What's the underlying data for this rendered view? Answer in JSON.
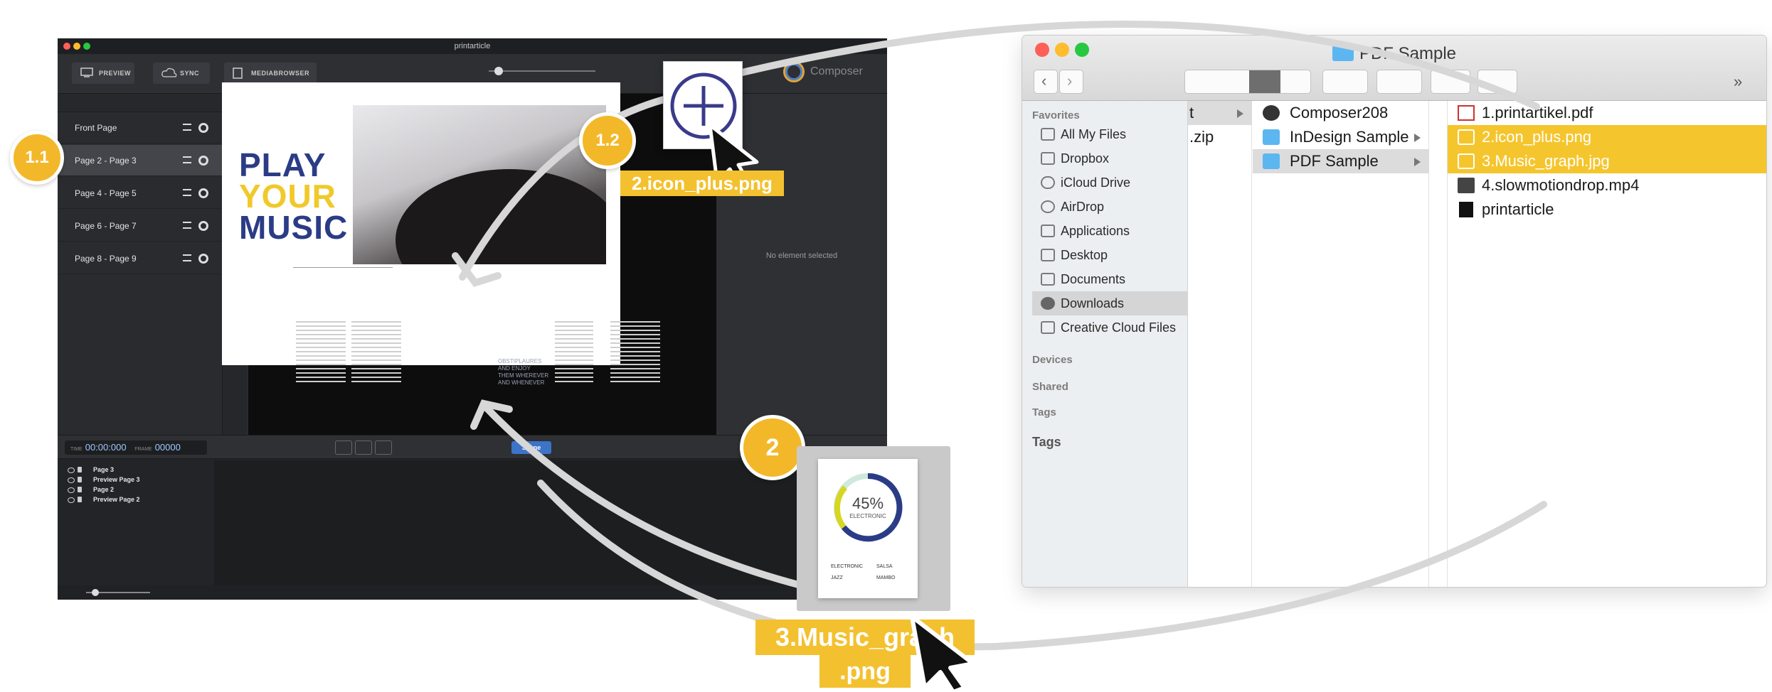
{
  "composer": {
    "window_title": "printarticle",
    "toolbar": {
      "preview": "PREVIEW",
      "sync": "SYNC",
      "mediabrowser": "MEDIABROWSER",
      "brand": "Composer"
    },
    "pages": [
      {
        "label": "Front Page"
      },
      {
        "label": "Page 2 - Page 3"
      },
      {
        "label": "Page 4 - Page 5"
      },
      {
        "label": "Page 6 - Page 7"
      },
      {
        "label": "Page 8 - Page 9"
      }
    ],
    "selected_page": "Page 2 - Page 3",
    "document": {
      "headline": [
        "PLAY",
        "YOUR",
        "MUSIC"
      ],
      "headline_colors": [
        "#2b3c86",
        "#f0c92a",
        "#2b3c86"
      ],
      "pull_quote": [
        "OBSTIPLAURES",
        "AND ENJOY",
        "THEM WHEREVER",
        "AND WHENEVER"
      ]
    },
    "properties": {
      "empty_message": "No element selected"
    },
    "timeline": {
      "time_label": "TIME",
      "time": "00:00:000",
      "frame_label": "FRAME",
      "frame": "00000",
      "scene_button": "Scene",
      "layers": [
        "Page 3",
        "Preview Page 3",
        "Page 2",
        "Preview Page 2"
      ]
    }
  },
  "finder": {
    "title": "PDF Sample",
    "sidebar": {
      "favorites_header": "Favorites",
      "items": [
        {
          "label": "All My Files",
          "icon": "all-files-icon"
        },
        {
          "label": "Dropbox",
          "icon": "dropbox-icon"
        },
        {
          "label": "iCloud Drive",
          "icon": "cloud-icon"
        },
        {
          "label": "AirDrop",
          "icon": "airdrop-icon"
        },
        {
          "label": "Applications",
          "icon": "applications-icon"
        },
        {
          "label": "Desktop",
          "icon": "desktop-icon"
        },
        {
          "label": "Documents",
          "icon": "documents-icon"
        },
        {
          "label": "Downloads",
          "icon": "downloads-icon"
        },
        {
          "label": "Creative Cloud Files",
          "icon": "folder-icon"
        }
      ],
      "devices_header": "Devices",
      "shared_header": "Shared",
      "tags_header": "Tags",
      "tags_header_2": "Tags"
    },
    "column1": [
      {
        "label": "t"
      },
      {
        "label": ".zip"
      }
    ],
    "column2": [
      {
        "label": "Composer208",
        "icon": "app-icon"
      },
      {
        "label": "InDesign Sample",
        "icon": "folder-icon"
      },
      {
        "label": "PDF Sample",
        "icon": "folder-icon"
      }
    ],
    "column3": [
      {
        "label": "1.printartikel.pdf",
        "icon": "pdf-icon"
      },
      {
        "label": "2.icon_plus.png",
        "icon": "image-icon"
      },
      {
        "label": "3.Music_graph.jpg",
        "icon": "image-icon"
      },
      {
        "label": "4.slowmotiondrop.mp4",
        "icon": "video-icon"
      },
      {
        "label": "printarticle",
        "icon": "document-icon"
      }
    ]
  },
  "annotations": {
    "badge_1_1": "1.1",
    "badge_1_2": "1.2",
    "badge_2": "2",
    "tag_icon_plus": "2.icon_plus.png",
    "tag_music_graph_line1": "3.Music_graph",
    "tag_music_graph_line2": ".png",
    "graph_percent": "45%",
    "graph_label": "ELECTRONIC",
    "graph_legend": [
      "ELECTRONIC",
      "SALSA",
      "JAZZ",
      "MAMBO"
    ]
  },
  "colors": {
    "accent_yellow": "#f3b829",
    "highlight": "#f5c52d",
    "composer_blue": "#2b3c86"
  }
}
